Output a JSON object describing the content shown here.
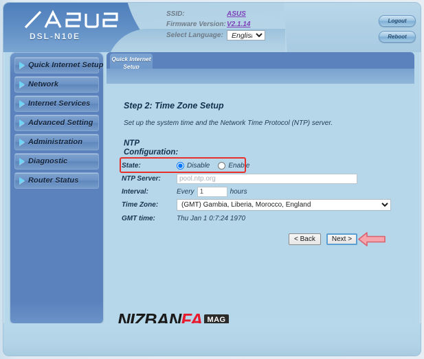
{
  "header": {
    "brand": "ASUS",
    "model": "DSL-N10E",
    "info_rows": [
      {
        "label": "SSID:",
        "value": "ASUS"
      },
      {
        "label": "Firmware Version:",
        "value": "V2.1.14"
      }
    ],
    "language_label": "Select Language:",
    "language_selected": "English",
    "language_options": [
      "English"
    ],
    "logout_button": "Logout",
    "reboot_button": "Reboot"
  },
  "sidebar": {
    "items": [
      {
        "label": "Quick Internet Setup"
      },
      {
        "label": "Network"
      },
      {
        "label": "Internet Services"
      },
      {
        "label": "Advanced Setting"
      },
      {
        "label": "Administration"
      },
      {
        "label": "Diagnostic"
      },
      {
        "label": "Router Status"
      }
    ]
  },
  "tabs": [
    {
      "label": "Quick Internet Setup",
      "active": true
    }
  ],
  "main": {
    "step_title": "Step 2: Time Zone Setup",
    "step_description": "Set up the system time and the Network Time Protocol (NTP) server.",
    "section_heading": "NTP Configuration:",
    "fields": {
      "state": {
        "label": "State:",
        "options": [
          {
            "label": "Disable",
            "selected": true
          },
          {
            "label": "Enable",
            "selected": false
          }
        ]
      },
      "ntp_server": {
        "label": "NTP Server:",
        "value": "",
        "placeholder": "pool.ntp.org"
      },
      "interval": {
        "label": "Interval:",
        "prefix": "Every",
        "value": "1",
        "suffix": "hours"
      },
      "time_zone": {
        "label": "Time Zone:",
        "selected": "(GMT) Gambia, Liberia, Morocco, England",
        "options": [
          "(GMT) Gambia, Liberia, Morocco, England"
        ]
      },
      "gmt_time": {
        "label": "GMT time:",
        "value": "Thu Jan 1 0:7:24 1970"
      }
    },
    "buttons": {
      "back": "< Back",
      "next": "Next >"
    }
  },
  "annotations": {
    "highlight_color": "#e8302a",
    "arrow_color": "#f4a5ad",
    "arrow_border": "#d9606d"
  },
  "watermark": {
    "part1": "N",
    "part2": "IZBAN",
    "part3": "FA",
    "badge": "MAG"
  }
}
